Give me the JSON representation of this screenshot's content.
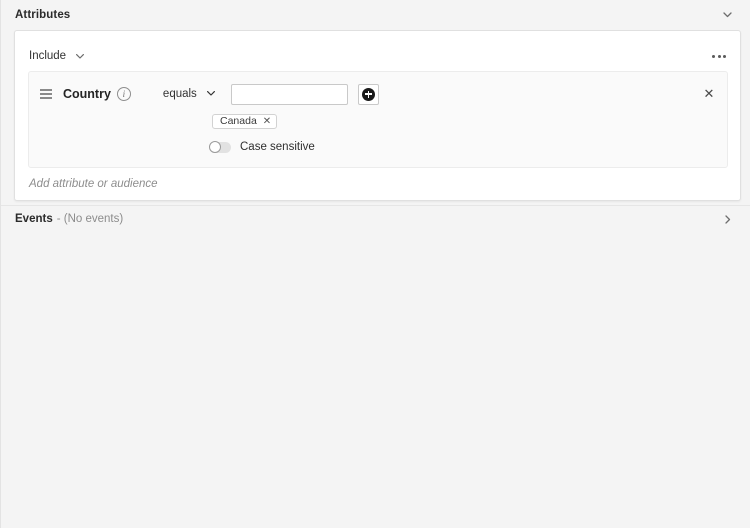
{
  "attributes_section": {
    "title": "Attributes",
    "collapse_icon": "chevron-down-icon",
    "card": {
      "scope_select": {
        "value": "Include",
        "caret_icon": "chevron-down-icon"
      },
      "overflow_menu_icon": "kebab-menu-icon",
      "condition": {
        "drag_handle_icon": "drag-handle-icon",
        "attribute_name": "Country",
        "info_icon": "info-icon",
        "operator": "equals",
        "operator_caret_icon": "chevron-down-icon",
        "value_input": {
          "value": "",
          "placeholder": ""
        },
        "add_value_button_icon": "plus-circle-icon",
        "chips": [
          {
            "label": "Canada",
            "remove_icon": "close-icon"
          }
        ],
        "case_sensitive": {
          "label": "Case sensitive",
          "state": "off"
        },
        "remove_icon": "close-icon"
      },
      "add_attribute_placeholder": "Add attribute or audience"
    }
  },
  "events_section": {
    "title": "Events",
    "summary": "- (No events)",
    "expand_icon": "chevron-right-icon"
  },
  "colors": {
    "page_background": "#f4f4f4",
    "card_background": "#ffffff",
    "panel_background": "#fafafa",
    "border": "#e0e0e0",
    "text_primary": "#2c2c2c",
    "text_muted": "#8c8c8c",
    "accent_dark": "#1a1a1a"
  }
}
